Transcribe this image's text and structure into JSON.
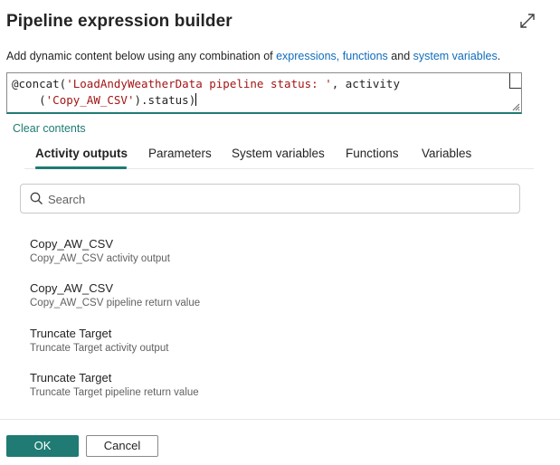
{
  "dialog": {
    "title": "Pipeline expression builder",
    "expand_icon": "expand-icon"
  },
  "description": {
    "prefix": "Add dynamic content below using any combination of ",
    "link_expressions": "expressions,",
    "link_functions": "functions",
    "middle": " and ",
    "link_system_variables": "system variables",
    "suffix": "."
  },
  "editor": {
    "line1_pre": "@concat(",
    "line1_str": "'LoadAndyWeatherData pipeline status: '",
    "line1_post": ", activity",
    "line2_pre": "    (",
    "line2_str": "'Copy_AW_CSV'",
    "line2_post": ").status)"
  },
  "clear_contents": "Clear contents",
  "tabs": [
    {
      "label": "Activity outputs",
      "active": true
    },
    {
      "label": "Parameters",
      "active": false
    },
    {
      "label": "System variables",
      "active": false
    },
    {
      "label": "Functions",
      "active": false
    },
    {
      "label": "Variables",
      "active": false
    }
  ],
  "search": {
    "placeholder": "Search",
    "icon": "search-icon"
  },
  "items": [
    {
      "title": "Copy_AW_CSV",
      "subtitle": "Copy_AW_CSV activity output"
    },
    {
      "title": "Copy_AW_CSV",
      "subtitle": "Copy_AW_CSV pipeline return value"
    },
    {
      "title": "Truncate Target",
      "subtitle": "Truncate Target activity output"
    },
    {
      "title": "Truncate Target",
      "subtitle": "Truncate Target pipeline return value"
    }
  ],
  "footer": {
    "ok_label": "OK",
    "cancel_label": "Cancel"
  },
  "colors": {
    "accent": "#1f7b73",
    "link": "#0f6cbd",
    "string": "#a31515"
  }
}
